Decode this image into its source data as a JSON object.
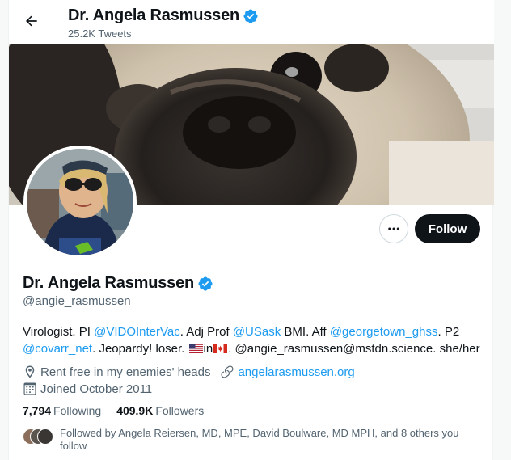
{
  "header": {
    "name": "Dr. Angela Rasmussen",
    "tweet_count": "25.2K Tweets"
  },
  "profile": {
    "name": "Dr. Angela Rasmussen",
    "handle": "@angie_rasmussen",
    "bio": {
      "t1": "Virologist. PI ",
      "l1": "@VIDOInterVac",
      "t2": ". Adj Prof ",
      "l2": "@USask",
      "t3": " BMI. Aff ",
      "l3": "@georgetown_ghss",
      "t4": ". P2 ",
      "l4": "@covarr_net",
      "t5": ". Jeopardy! loser. ",
      "t6": "in",
      "t7": ". @angie_rasmussen@mstdn.science. she/her"
    },
    "location": "Rent free in my enemies' heads",
    "website": "angelarasmussen.org",
    "joined": "Joined October 2011"
  },
  "stats": {
    "following_count": "7,794",
    "following_label": "Following",
    "followers_count": "409.9K",
    "followers_label": "Followers"
  },
  "followed_by": "Followed by Angela Reiersen, MD, MPE, David Boulware, MD MPH, and 8 others you follow",
  "buttons": {
    "follow": "Follow"
  },
  "icons": {
    "back": "arrow-left-icon",
    "verified": "verified-badge-icon",
    "more": "more-dots-icon",
    "location": "location-pin-icon",
    "link": "link-icon",
    "calendar": "calendar-icon",
    "flags": [
      "us-flag-icon",
      "canada-flag-icon"
    ]
  },
  "colors": {
    "accent": "#1d9bf0",
    "text": "#0f1419",
    "muted": "#536471",
    "follow_bg": "#0f1419"
  }
}
